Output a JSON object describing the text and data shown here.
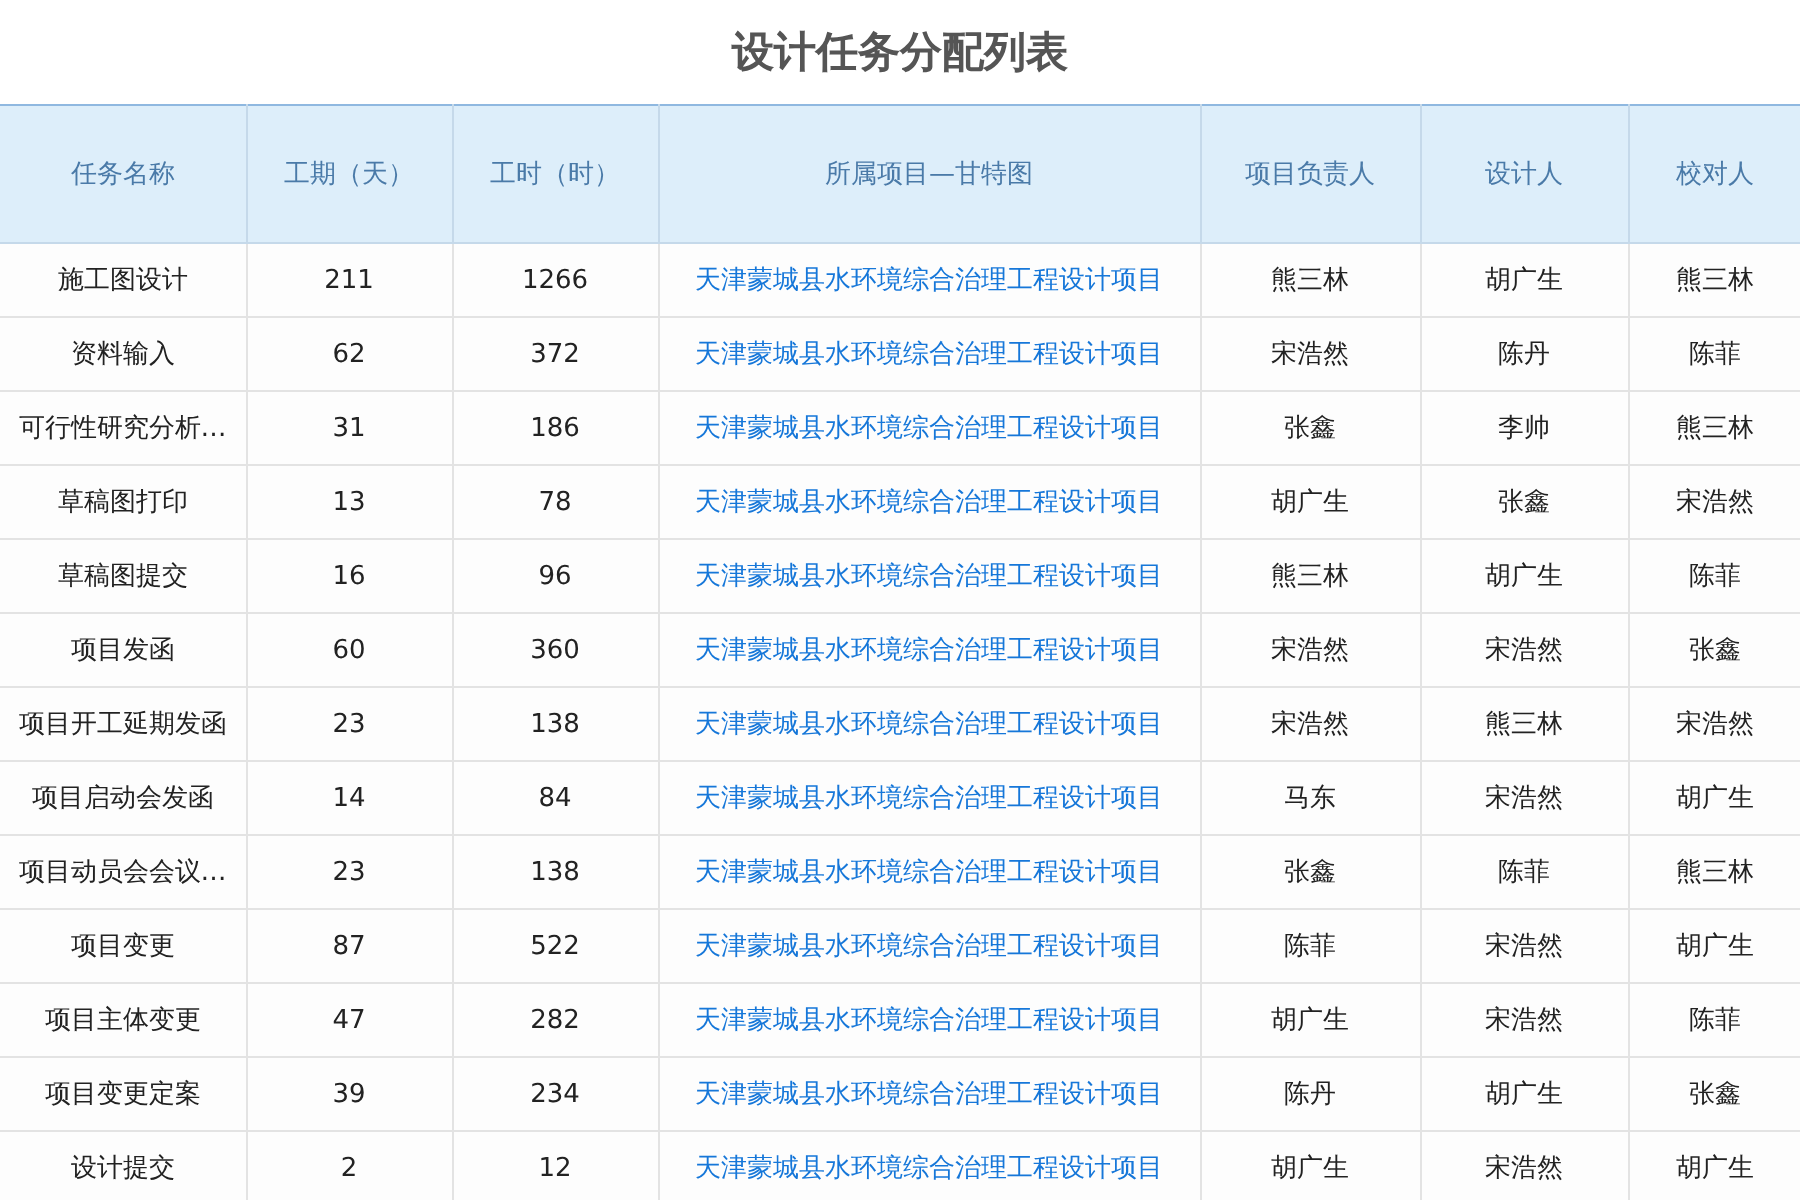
{
  "title": "设计任务分配列表",
  "table": {
    "columns": [
      {
        "label": "任务名称",
        "kind": "text"
      },
      {
        "label": "工期（天）",
        "kind": "text"
      },
      {
        "label": "工时（时）",
        "kind": "text"
      },
      {
        "label": "所属项目—甘特图",
        "kind": "link"
      },
      {
        "label": "项目负责人",
        "kind": "text"
      },
      {
        "label": "设计人",
        "kind": "text"
      },
      {
        "label": "校对人",
        "kind": "text"
      }
    ],
    "rows": [
      [
        "施工图设计",
        "211",
        "1266",
        "天津蒙城县水环境综合治理工程设计项目",
        "熊三林",
        "胡广生",
        "熊三林"
      ],
      [
        "资料输入",
        "62",
        "372",
        "天津蒙城县水环境综合治理工程设计项目",
        "宋浩然",
        "陈丹",
        "陈菲"
      ],
      [
        "可行性研究分析…",
        "31",
        "186",
        "天津蒙城县水环境综合治理工程设计项目",
        "张鑫",
        "李帅",
        "熊三林"
      ],
      [
        "草稿图打印",
        "13",
        "78",
        "天津蒙城县水环境综合治理工程设计项目",
        "胡广生",
        "张鑫",
        "宋浩然"
      ],
      [
        "草稿图提交",
        "16",
        "96",
        "天津蒙城县水环境综合治理工程设计项目",
        "熊三林",
        "胡广生",
        "陈菲"
      ],
      [
        "项目发函",
        "60",
        "360",
        "天津蒙城县水环境综合治理工程设计项目",
        "宋浩然",
        "宋浩然",
        "张鑫"
      ],
      [
        "项目开工延期发函",
        "23",
        "138",
        "天津蒙城县水环境综合治理工程设计项目",
        "宋浩然",
        "熊三林",
        "宋浩然"
      ],
      [
        "项目启动会发函",
        "14",
        "84",
        "天津蒙城县水环境综合治理工程设计项目",
        "马东",
        "宋浩然",
        "胡广生"
      ],
      [
        "项目动员会会议…",
        "23",
        "138",
        "天津蒙城县水环境综合治理工程设计项目",
        "张鑫",
        "陈菲",
        "熊三林"
      ],
      [
        "项目变更",
        "87",
        "522",
        "天津蒙城县水环境综合治理工程设计项目",
        "陈菲",
        "宋浩然",
        "胡广生"
      ],
      [
        "项目主体变更",
        "47",
        "282",
        "天津蒙城县水环境综合治理工程设计项目",
        "胡广生",
        "宋浩然",
        "陈菲"
      ],
      [
        "项目变更定案",
        "39",
        "234",
        "天津蒙城县水环境综合治理工程设计项目",
        "陈丹",
        "胡广生",
        "张鑫"
      ],
      [
        "设计提交",
        "2",
        "12",
        "天津蒙城县水环境综合治理工程设计项目",
        "胡广生",
        "宋浩然",
        "胡广生"
      ]
    ]
  }
}
